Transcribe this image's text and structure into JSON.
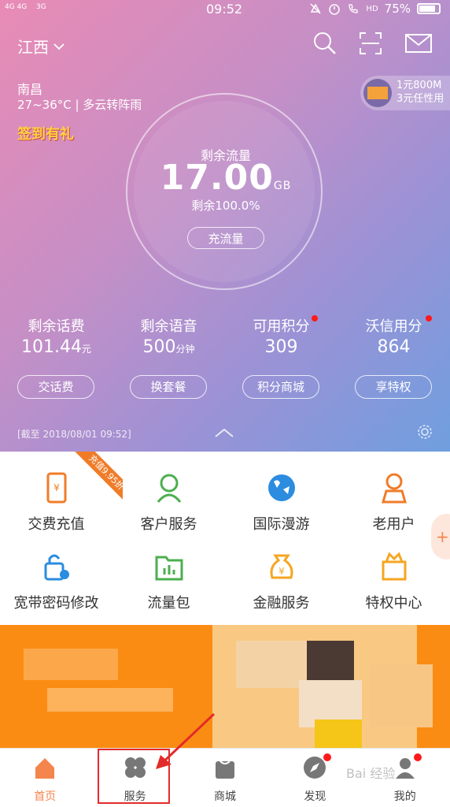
{
  "status_bar": {
    "signal1": "4G 4G",
    "signal2": "3G",
    "time": "09:52",
    "hd": "HD",
    "battery": "75%"
  },
  "header": {
    "region": "江西",
    "icons": [
      "search-icon",
      "scan-icon",
      "mail-icon"
    ]
  },
  "weather": {
    "city": "南昌",
    "info": "27~36°C | 多云转阵雨"
  },
  "checkin": "签到有礼",
  "promo": {
    "line1": "1元800M",
    "line2": "3元任性用"
  },
  "flow": {
    "label": "剩余流量",
    "value": "17.00",
    "unit": "GB",
    "percent": "剩余100.0%",
    "button": "充流量"
  },
  "stats": [
    {
      "label": "剩余话费",
      "value": "101.44",
      "unit": "元",
      "button": "交话费",
      "dot": false
    },
    {
      "label": "剩余语音",
      "value": "500",
      "unit": "分钟",
      "button": "换套餐",
      "dot": false
    },
    {
      "label": "可用积分",
      "value": "309",
      "unit": "",
      "button": "积分商城",
      "dot": true
    },
    {
      "label": "沃信用分",
      "value": "864",
      "unit": "",
      "button": "享特权",
      "dot": true
    }
  ],
  "updated": "[截至 2018/08/01 09:52]",
  "services": [
    {
      "label": "交费充值",
      "icon": "phone-yuan-icon"
    },
    {
      "label": "客户服务",
      "icon": "customer-service-icon"
    },
    {
      "label": "国际漫游",
      "icon": "globe-icon"
    },
    {
      "label": "老用户",
      "icon": "user-icon"
    },
    {
      "label": "宽带密码修改",
      "icon": "lock-gear-icon"
    },
    {
      "label": "流量包",
      "icon": "folder-chart-icon"
    },
    {
      "label": "金融服务",
      "icon": "money-bag-icon"
    },
    {
      "label": "特权中心",
      "icon": "crown-bag-icon"
    }
  ],
  "ribbon": "充值9.95折",
  "float_button": "+",
  "tabs": [
    {
      "label": "首页",
      "icon": "home-icon",
      "active": true,
      "dot": false
    },
    {
      "label": "服务",
      "icon": "grid-icon",
      "active": false,
      "dot": false
    },
    {
      "label": "商城",
      "icon": "bag-icon",
      "active": false,
      "dot": false
    },
    {
      "label": "发现",
      "icon": "compass-icon",
      "active": false,
      "dot": true
    },
    {
      "label": "我的",
      "icon": "profile-icon",
      "active": false,
      "dot": true
    }
  ],
  "watermark": "Bai 经验",
  "colors": {
    "accent": "#f4854d",
    "dot": "#ff1a1a",
    "banner": "#fb8c13",
    "highlight": "#e32b2b"
  }
}
